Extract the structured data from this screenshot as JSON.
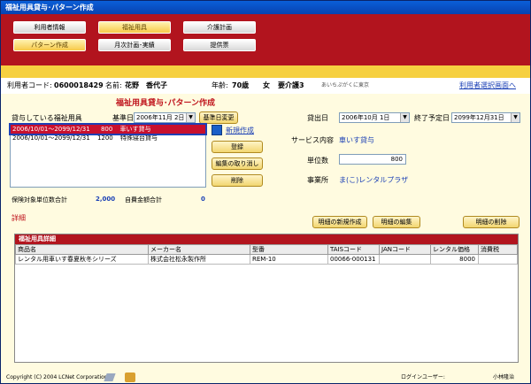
{
  "window": {
    "title": "福祉用具貸与･パターン作成"
  },
  "nav": {
    "row1": [
      "利用者情報",
      "福祉用具",
      "介護計画"
    ],
    "row2": [
      "パターン作成",
      "月次計画･実績",
      "提供票"
    ]
  },
  "userbar": {
    "code_label": "利用者コード:",
    "code": "0600018429",
    "name_label": "名前:",
    "name": "花野　香代子",
    "age_label": "年齢:",
    "age": "70歳",
    "gender": "女",
    "care_level": "要介護3",
    "office": "あいちぷがくに東京",
    "link": "利用者選択画面へ"
  },
  "page": {
    "title": "福祉用具貸与･パターン作成"
  },
  "rental": {
    "list_title": "貸与している福祉用具",
    "base_date_label": "基準日",
    "base_date": "2006年11月 2日",
    "base_date_button": "基準日変更",
    "items": [
      {
        "period": "2006/10/01～2099/12/31",
        "units": "800",
        "name": "車いす貸与"
      },
      {
        "period": "2006/10/01～2099/12/31",
        "units": "1200",
        "name": "特殊寝台貸与"
      }
    ],
    "new_link": "新規作成",
    "buttons": {
      "register": "登録",
      "cancel_edit": "編集の取り消し",
      "delete": "削除"
    },
    "insured_total_label": "保険対象単位数合計",
    "insured_total": "2,000",
    "self_pay_label": "自費金額合計",
    "self_pay": "0"
  },
  "form": {
    "start_label": "貸出日",
    "start_date": "2006年10月 1日",
    "end_label": "終了予定日",
    "end_date": "2099年12月31日",
    "service_label": "サービス内容",
    "service": "車いす貸与",
    "units_label": "単位数",
    "units": "800",
    "office_label": "事業所",
    "office": "ま(こ)レンタルプラザ"
  },
  "detail": {
    "section_label": "詳細",
    "new_button": "明細の新規作成",
    "edit_button": "明細の編集",
    "delete_button": "明細の削除",
    "table_title": "福祉用具詳細",
    "columns": [
      "商品名",
      "メーカー名",
      "型番",
      "TAISコード",
      "JANコード",
      "レンタル価格",
      "消費税"
    ],
    "rows": [
      [
        "レンタル用車いす春夏秋冬シリーズ",
        "株式会社松永製作所",
        "REM-10",
        "00066-000131",
        "",
        "8000",
        ""
      ]
    ]
  },
  "footer": {
    "copyright": "Copyright (C) 2004 LCNet Corporation",
    "login_label": "ログインユーザー:",
    "login_user": "小林隆治"
  },
  "colors": {
    "nav_red": "#b2141e",
    "title_red": "#c0161e",
    "panel_cream": "#fffbe0"
  }
}
